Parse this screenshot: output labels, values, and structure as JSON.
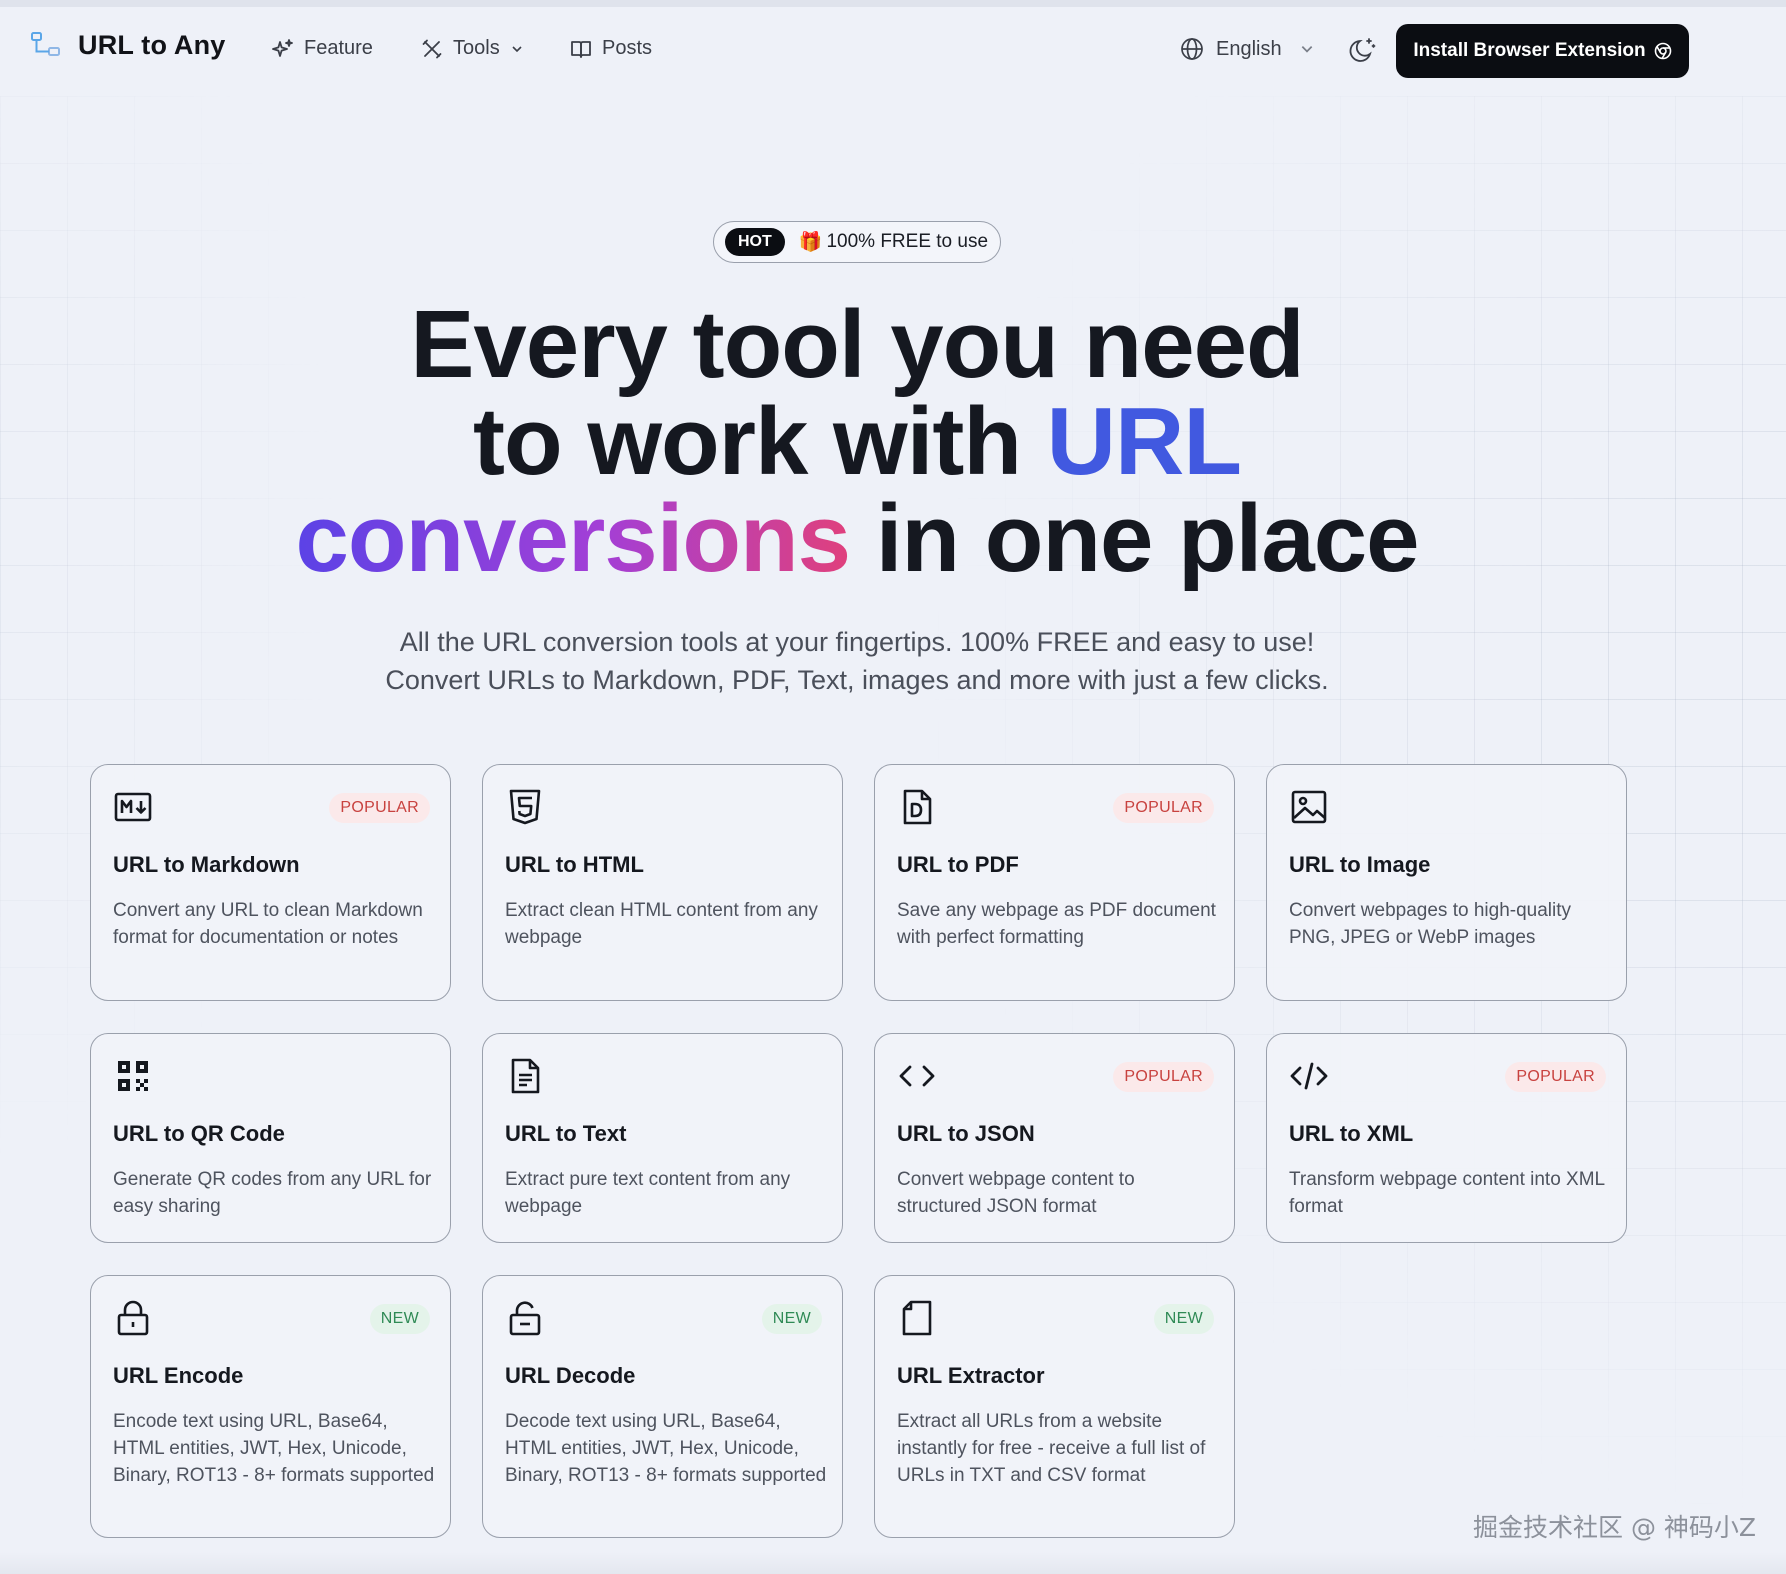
{
  "nav": {
    "brand": "URL to Any",
    "items": [
      {
        "label": "Feature",
        "icon": "sparkles-icon"
      },
      {
        "label": "Tools",
        "icon": "tools-icon",
        "dropdown": true
      },
      {
        "label": "Posts",
        "icon": "book-icon"
      }
    ],
    "language": "English",
    "install_label": "Install Browser Extension"
  },
  "hero": {
    "badge_hot": "HOT",
    "badge_text": "100% FREE to use",
    "badge_emoji": "🎁",
    "headline_line1": "Every tool you need",
    "headline_line2_a": "to work with ",
    "headline_line2_b": "URL",
    "headline_line3_a": "conversions",
    "headline_line3_b": " in one place",
    "sub_line1": "All the URL conversion tools at your fingertips. 100% FREE and easy to use!",
    "sub_line2": "Convert URLs to Markdown, PDF, Text, images and more with just a few clicks."
  },
  "cards": [
    {
      "title": "URL to Markdown",
      "desc": "Convert any URL to clean Markdown format for documentation or notes",
      "tag": "POPULAR",
      "icon": "markdown-icon"
    },
    {
      "title": "URL to HTML",
      "desc": "Extract clean HTML content from any webpage",
      "tag": "",
      "icon": "html5-icon"
    },
    {
      "title": "URL to PDF",
      "desc": "Save any webpage as PDF document with perfect formatting",
      "tag": "POPULAR",
      "icon": "pdf-icon"
    },
    {
      "title": "URL to Image",
      "desc": "Convert webpages to high-quality PNG, JPEG or WebP images",
      "tag": "",
      "icon": "image-icon"
    },
    {
      "title": "URL to QR Code",
      "desc": "Generate QR codes from any URL for easy sharing",
      "tag": "",
      "icon": "qrcode-icon"
    },
    {
      "title": "URL to Text",
      "desc": "Extract pure text content from any webpage",
      "tag": "",
      "icon": "text-file-icon"
    },
    {
      "title": "URL to JSON",
      "desc": "Convert webpage content to structured JSON format",
      "tag": "POPULAR",
      "icon": "code-brackets-icon"
    },
    {
      "title": "URL to XML",
      "desc": "Transform webpage content into XML format",
      "tag": "POPULAR",
      "icon": "code-slash-icon"
    },
    {
      "title": "URL Encode",
      "desc": "Encode text using URL, Base64, HTML entities, JWT, Hex, Unicode, Binary, ROT13 - 8+ formats supported",
      "tag": "NEW",
      "icon": "lock-icon"
    },
    {
      "title": "URL Decode",
      "desc": "Decode text using URL, Base64, HTML entities, JWT, Hex, Unicode, Binary, ROT13 - 8+ formats supported",
      "tag": "NEW",
      "icon": "unlock-icon"
    },
    {
      "title": "URL Extractor",
      "desc": "Extract all URLs from a website instantly for free - receive a full list of URLs in TXT and CSV format",
      "tag": "NEW",
      "icon": "file-icon"
    }
  ],
  "watermark": "掘金技术社区 @ 神码小Z",
  "colors": {
    "accent_blue": "#4159e0",
    "gradient_start": "#5b42e6",
    "gradient_end": "#e0407c",
    "popular_tag": "#c8423f",
    "new_tag": "#2f8a55",
    "button_dark": "#0b0d12"
  }
}
